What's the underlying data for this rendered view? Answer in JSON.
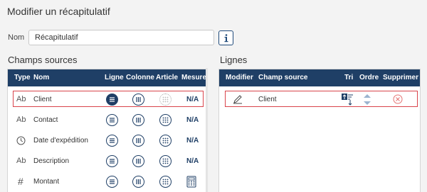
{
  "dialog": {
    "title": "Modifier un récapitulatif"
  },
  "name_field": {
    "label": "Nom",
    "value": "Récapitulatif"
  },
  "sources": {
    "title": "Champs sources",
    "headers": [
      "Type",
      "Nom",
      "Ligne",
      "Colonne",
      "Article",
      "Mesure"
    ],
    "rows": [
      {
        "type_icon": "text-type-icon",
        "type_text": "Ab",
        "name": "Client",
        "ligne": "selected",
        "colonne": "available",
        "article": "disabled",
        "mesure": "N/A"
      },
      {
        "type_icon": "text-type-icon",
        "type_text": "Ab",
        "name": "Contact",
        "ligne": "available",
        "colonne": "available",
        "article": "available",
        "mesure": "N/A"
      },
      {
        "type_icon": "clock-icon",
        "type_text": "",
        "name": "Date d'expédition",
        "ligne": "available",
        "colonne": "available",
        "article": "available",
        "mesure": "N/A"
      },
      {
        "type_icon": "text-type-icon",
        "type_text": "Ab",
        "name": "Description",
        "ligne": "available",
        "colonne": "available",
        "article": "available",
        "mesure": "N/A"
      },
      {
        "type_icon": "hash-icon",
        "type_text": "#",
        "name": "Montant",
        "ligne": "available",
        "colonne": "available",
        "article": "available",
        "mesure": "calculator"
      }
    ]
  },
  "lines": {
    "title": "Lignes",
    "headers": [
      "Modifier",
      "Champ source",
      "Tri",
      "Ordre",
      "Supprimer"
    ],
    "rows": [
      {
        "field": "Client"
      }
    ]
  },
  "colors": {
    "header_bg": "#1f3f66",
    "selection_border": "#d9434b",
    "delete": "#e57373"
  }
}
